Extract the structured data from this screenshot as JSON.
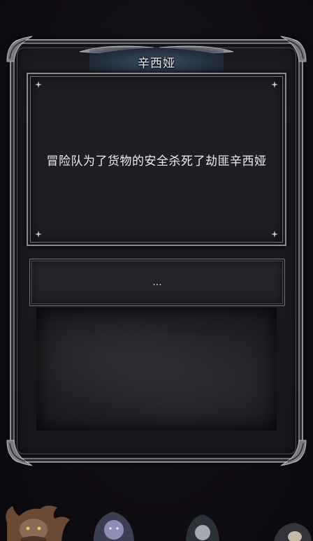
{
  "dialog": {
    "title": "辛西娅",
    "message": "冒险队为了货物的安全杀死了劫匪辛西娅",
    "choice_label": "..."
  },
  "colors": {
    "background": "#0f0c12",
    "frame_border": "#8d8f96",
    "banner_accent": "#3a5064",
    "panel": "#1f1e23",
    "text": "#eceef2"
  },
  "icons": {
    "corner_ornament": "silver-filigree",
    "sparkle": "four-point-star"
  },
  "portraits": [
    "horned-beast-portrait",
    "hooded-elf-portrait",
    "hooded-rogue-portrait",
    "hooded-figure-portrait"
  ]
}
